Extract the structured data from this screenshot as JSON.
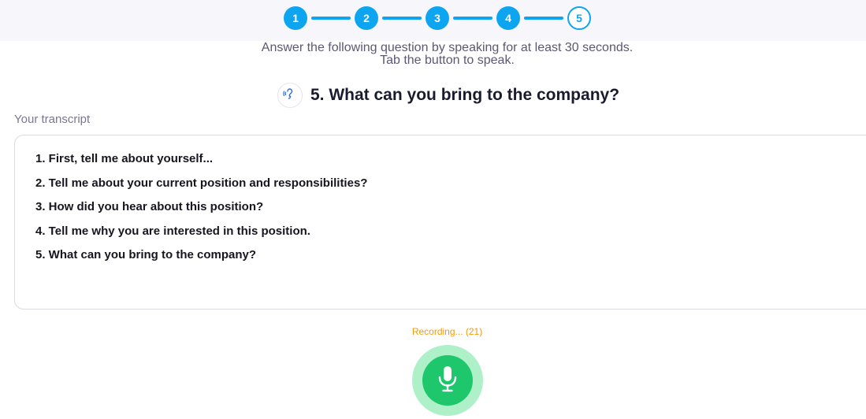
{
  "stepper": {
    "steps": [
      "1",
      "2",
      "3",
      "4",
      "5"
    ],
    "current_step": "5",
    "accent_color": "#0ea5f0"
  },
  "instructions": {
    "line1": "Answer the following question by speaking for at least 30 seconds.",
    "line2": "Tab the button to speak."
  },
  "question": {
    "title": "5. What can you bring to the company?",
    "audio_icon": "ear-sound-icon"
  },
  "transcript": {
    "label": "Your transcript",
    "items": [
      "1. First, tell me about yourself...",
      "2. Tell me about your current position and responsibilities?",
      "3. How did you hear about this position?",
      "4. Tell me why you are interested in this position.",
      "5. What can you bring to the company?"
    ]
  },
  "recording": {
    "status": "Recording... (21)",
    "status_color": "#f29a0f",
    "mic_icon": "microphone-icon",
    "button_color": "#1ec76b"
  }
}
